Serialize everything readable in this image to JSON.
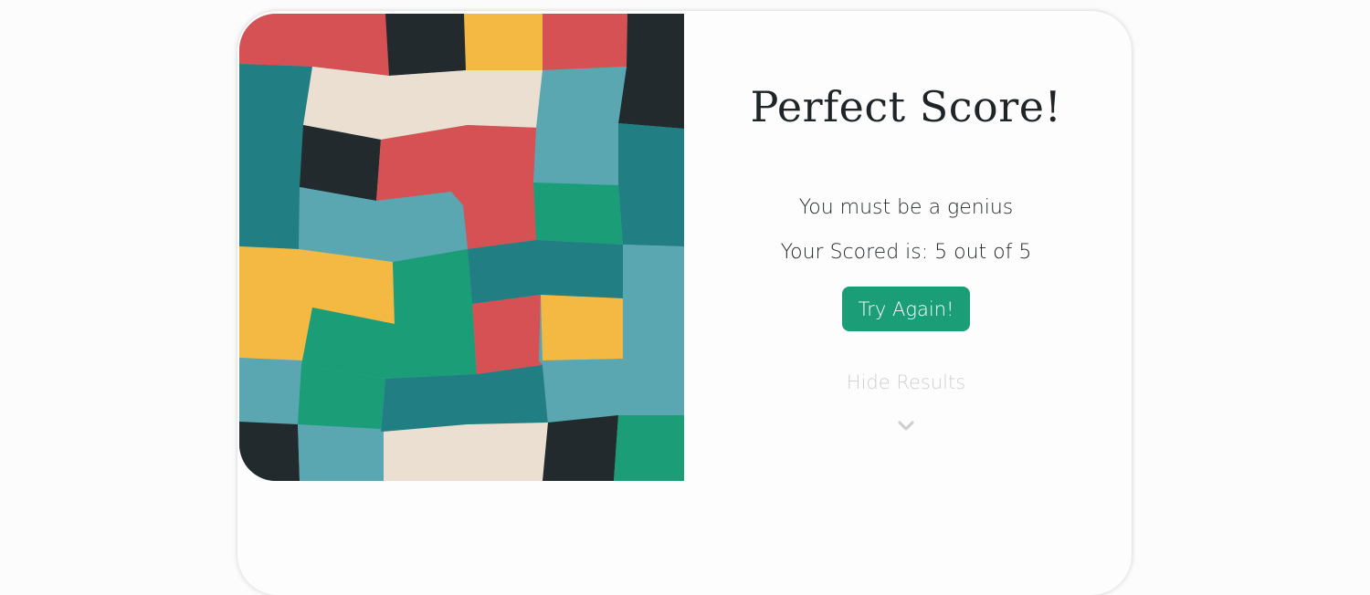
{
  "results": {
    "title": "Perfect Score!",
    "subtitle": "You must be a genius",
    "score_text": "Your Scored is: 5 out of 5",
    "try_again_label": "Try Again!",
    "hide_results_label": "Hide Results",
    "toggle_icon": "chevron-down-icon"
  },
  "colors": {
    "accent": "#1b9e77",
    "red": "#d65153",
    "dark": "#232a2e",
    "yellow": "#f4b942",
    "cream": "#ebdfd1",
    "teal": "#217e83",
    "light_teal": "#5aa7b1",
    "green": "#1b9e77",
    "muted_text": "#cfcfcf"
  }
}
